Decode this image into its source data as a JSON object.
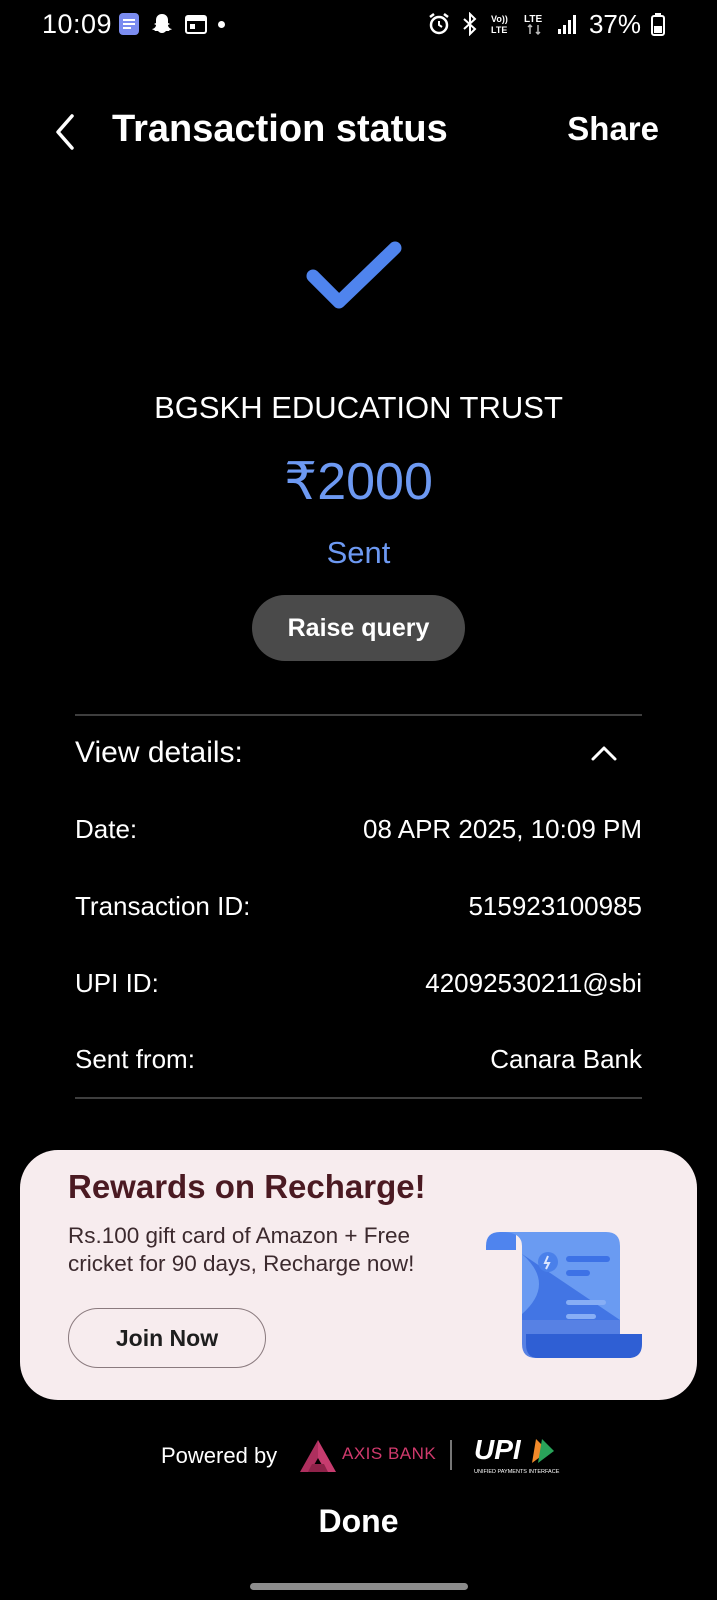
{
  "status_bar": {
    "time": "10:09",
    "battery": "37%",
    "icons": [
      "docs-icon",
      "snapchat-icon",
      "calendar-icon",
      "notification-dot",
      "alarm-icon",
      "bluetooth-icon",
      "volte-icon",
      "lte-icon",
      "signal-icon",
      "battery-icon"
    ]
  },
  "header": {
    "title": "Transaction status",
    "share_label": "Share"
  },
  "transaction": {
    "payee": "BGSKH EDUCATION TRUST",
    "amount": "₹2000",
    "status": "Sent",
    "raise_query_label": "Raise query"
  },
  "details": {
    "heading": "View details:",
    "rows": [
      {
        "label": "Date:",
        "value": "08 APR 2025, 10:09 PM"
      },
      {
        "label": "Transaction ID:",
        "value": "515923100985"
      },
      {
        "label": "UPI ID:",
        "value": "42092530211@sbi"
      },
      {
        "label": "Sent from:",
        "value": "Canara Bank"
      }
    ]
  },
  "promo": {
    "title": "Rewards on Recharge!",
    "text": "Rs.100 gift card of Amazon + Free cricket for 90 days, Recharge now!",
    "button_label": "Join Now"
  },
  "footer": {
    "powered_by": "Powered by",
    "bank_name": "AXIS BANK",
    "upi_subtext": "UNIFIED PAYMENTS INTERFACE",
    "done_label": "Done"
  },
  "colors": {
    "accent": "#6d99f2",
    "check": "#4f84ee",
    "promo_bg": "#f7ecee",
    "promo_title": "#4b1a22",
    "axis": "#ae2f5e"
  }
}
